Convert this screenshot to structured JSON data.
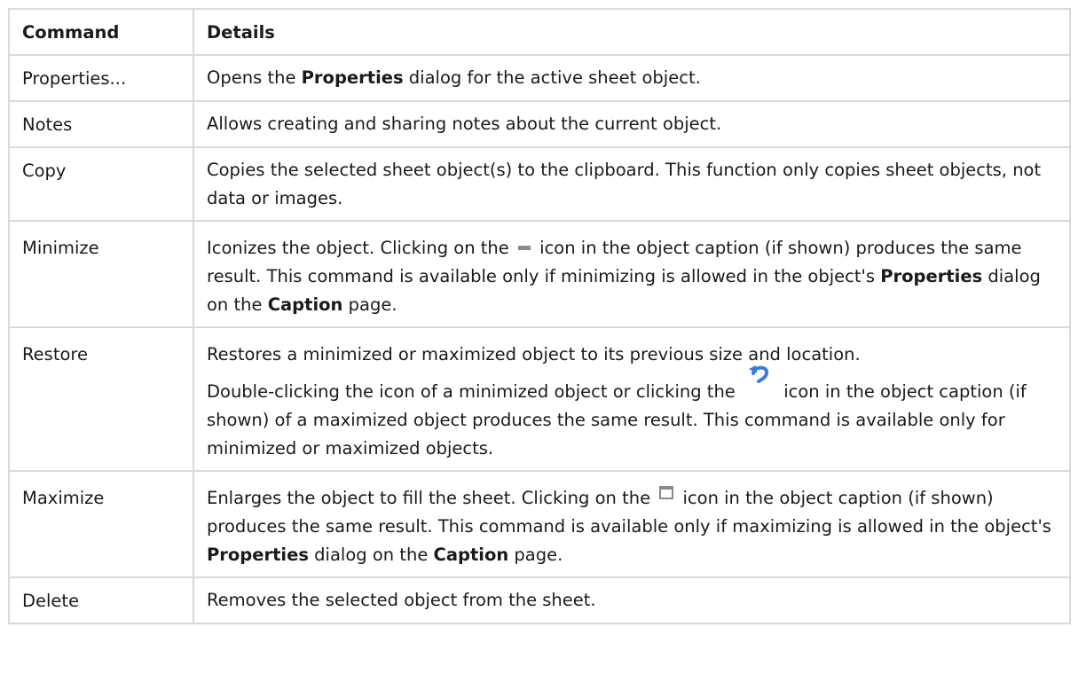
{
  "table": {
    "headers": {
      "command": "Command",
      "details": "Details"
    },
    "rows": [
      {
        "command": "Properties...",
        "details": [
          {
            "t": "Opens the "
          },
          {
            "b": "Properties"
          },
          {
            "t": " dialog for the active sheet object."
          }
        ]
      },
      {
        "command": "Notes",
        "details": [
          {
            "t": "Allows creating and sharing notes about the current object."
          }
        ]
      },
      {
        "command": "Copy",
        "details": [
          {
            "t": "Copies the selected sheet object(s) to the clipboard. This function only copies sheet objects, not data or images."
          }
        ]
      },
      {
        "command": "Minimize",
        "details": [
          {
            "t": "Iconizes the object. Clicking on the"
          },
          {
            "icon": "minimize-icon"
          },
          {
            "t": "icon in the object caption (if shown) produces the same result. This command is available only if minimizing is allowed in the object's "
          },
          {
            "b": "Properties"
          },
          {
            "t": " dialog on the "
          },
          {
            "b": "Caption"
          },
          {
            "t": " page."
          }
        ]
      },
      {
        "command": "Restore",
        "details": [
          {
            "t": "Restores a minimized or maximized object to its previous size and location."
          }
        ],
        "details2": [
          {
            "t": "Double-clicking the icon of a minimized object or clicking the"
          },
          {
            "icon": "restore-icon"
          },
          {
            "t": "icon in the object caption (if shown) of a maximized object produces the same result. This command is available only for minimized or maximized objects."
          }
        ]
      },
      {
        "command": "Maximize",
        "details": [
          {
            "t": "Enlarges the object to fill the sheet. Clicking on the"
          },
          {
            "icon": "maximize-icon"
          },
          {
            "t": "icon in the object caption (if shown) produces the same result. This command is available only if maximizing is allowed in the object's "
          },
          {
            "b": "Properties"
          },
          {
            "t": " dialog on the "
          },
          {
            "b": "Caption"
          },
          {
            "t": " page."
          }
        ]
      },
      {
        "command": "Delete",
        "details": [
          {
            "t": "Removes the selected object from the sheet."
          }
        ]
      }
    ]
  },
  "icons": {
    "restore_color": "#3d7bd9",
    "window_icon_color": "#8a8a8a"
  }
}
